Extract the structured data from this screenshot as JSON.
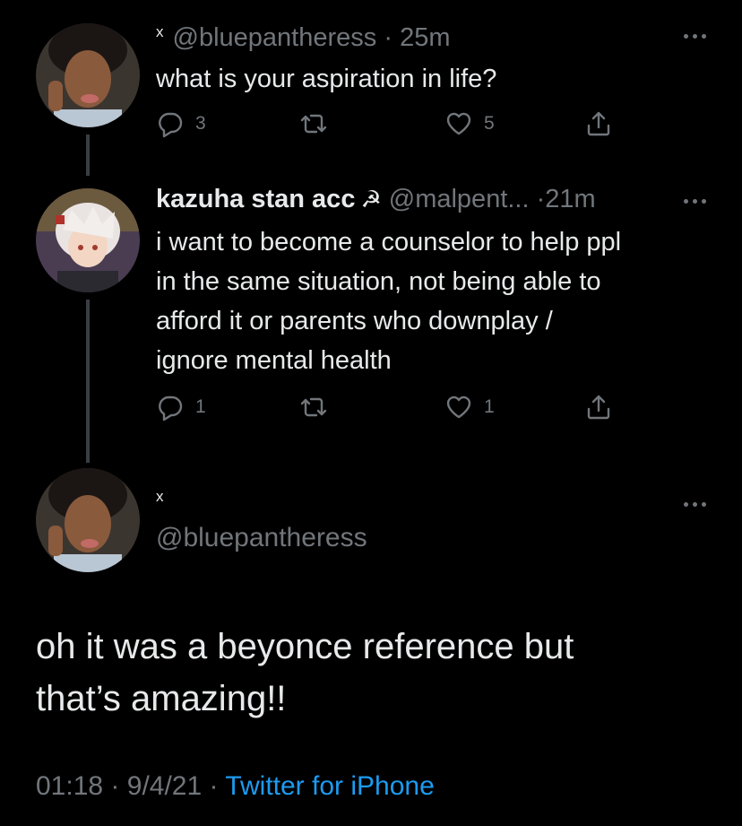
{
  "tweets": [
    {
      "mark": "x",
      "handle": "@bluepantheress",
      "sep": "·",
      "time": "25m",
      "text": "what is your aspiration in life?",
      "replies": "3",
      "retweets": "",
      "likes": "5"
    },
    {
      "display_name": "kazuha stan acc",
      "flag_icon": "☭",
      "handle": "@malpent...",
      "sep": "·",
      "time": "21m",
      "text_lines": [
        "i want to become a counselor to help ppl",
        "in the same situation, not being able to",
        "afford it or parents who downplay /",
        "ignore mental health"
      ],
      "replies": "1",
      "retweets": "",
      "likes": "1"
    }
  ],
  "focused": {
    "mark": "x",
    "handle": "@bluepantheress",
    "text_lines": [
      "oh it was a beyonce reference but",
      "that’s amazing!!"
    ],
    "time": "01:18",
    "date": "9/4/21",
    "sep": "·",
    "source": "Twitter for iPhone"
  },
  "colors": {
    "background": "#000000",
    "text": "#e7e9ea",
    "muted": "#71767b",
    "link": "#1d9bf0",
    "thread_line": "#3a3e42"
  },
  "icons": [
    "reply-icon",
    "retweet-icon",
    "like-icon",
    "share-icon",
    "more-icon"
  ]
}
